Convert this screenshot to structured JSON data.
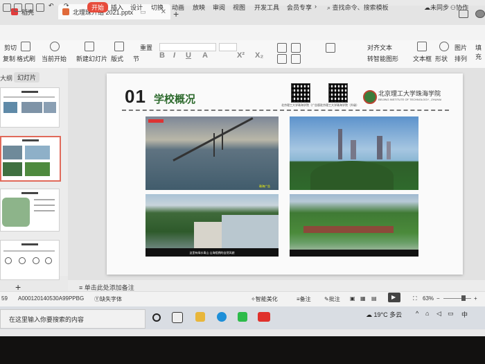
{
  "tabs": [
    {
      "label": "稻壳",
      "color": "#e03c3c"
    },
    {
      "label": "北理珠介绍 2021.pptx",
      "color": "#e06a3a"
    }
  ],
  "menu": [
    "开始",
    "插入",
    "设计",
    "切换",
    "动画",
    "放映",
    "审阅",
    "视图",
    "开发工具",
    "会员专享"
  ],
  "menu_active": "开始",
  "search_placeholder": "查找命令、搜索模板",
  "sync": "未同步",
  "collab": "协作",
  "ribbon": {
    "cut": "剪切",
    "copy": "复制",
    "format_painter": "格式刷",
    "from_start": "当前开始",
    "new_slide": "新建幻灯片",
    "layout": "版式",
    "section": "节",
    "reset": "重置",
    "align_text": "对齐文本",
    "smart_graphic": "转智能图形",
    "textbox": "文本框",
    "shape": "形状",
    "arrange": "排列",
    "picture": "图片",
    "fill": "填充"
  },
  "left": {
    "outline": "大纲",
    "slides": "幻灯片"
  },
  "slide": {
    "number": "01",
    "title": "学校概况",
    "qr1_caption": "北京理工大学珠海学院（广告版）",
    "qr2_caption": "北京理工大学珠海学院（升级）",
    "university_cn": "北京理工大学珠海学院",
    "university_en": "BEIJING INSTITUTE OF TECHNOLOGY , ZHUHAI",
    "photo1_caption": "珠海广告",
    "photo3_caption": "这里有绿水青山 山海相拥的自然风貌"
  },
  "notes_hint": "单击此处添加备注",
  "status": {
    "slide_no": "59",
    "file_code": "A000120140530A99PPBG",
    "missing_font": "缺失字体",
    "smart_beautify": "智能美化",
    "notes": "备注",
    "comments": "批注",
    "zoom": "63%"
  },
  "taskbar": {
    "search_placeholder": "在这里输入你要搜索的内容",
    "weather": "19°C 多云",
    "ime": "中"
  }
}
